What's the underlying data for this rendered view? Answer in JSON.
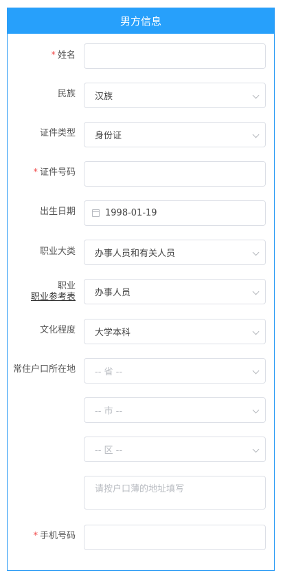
{
  "header": {
    "title": "男方信息"
  },
  "fields": {
    "name": {
      "label": "姓名",
      "required": true,
      "value": ""
    },
    "ethnicity": {
      "label": "民族",
      "value": "汉族"
    },
    "id_type": {
      "label": "证件类型",
      "value": "身份证"
    },
    "id_number": {
      "label": "证件号码",
      "required": true,
      "value": ""
    },
    "birth_date": {
      "label": "出生日期",
      "value": "1998-01-19"
    },
    "occupation_category": {
      "label": "职业大类",
      "value": "办事人员和有关人员"
    },
    "occupation": {
      "label_line1": "职业",
      "label_link": "职业参考表",
      "value": "办事人员"
    },
    "education": {
      "label": "文化程度",
      "value": "大学本科"
    },
    "residence": {
      "label": "常住户口所在地",
      "province_placeholder": "-- 省 --",
      "city_placeholder": "-- 市 --",
      "district_placeholder": "-- 区 --",
      "address_placeholder": "请按户口薄的地址填写"
    },
    "phone": {
      "label": "手机号码",
      "required": true,
      "value": ""
    }
  },
  "required_mark": "*"
}
